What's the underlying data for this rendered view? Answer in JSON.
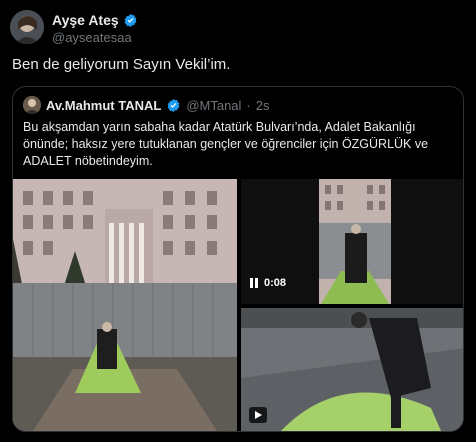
{
  "tweet": {
    "author": {
      "display_name": "Ayşe Ateş",
      "handle": "@ayseatesaa"
    },
    "text": "Ben de geliyorum Sayın Vekil’im."
  },
  "quoted": {
    "author": {
      "display_name": "Av.Mahmut TANAL",
      "handle": "@MTanal"
    },
    "separator": "·",
    "time": "2s",
    "text": "Bu akşamdan yarın sabaha kadar Atatürk Bulvarı’nda, Adalet Bakanlığı önünde; haksız yere tutuklanan gençler ve öğrenciler için ÖZGÜRLÜK ve ADALET nöbetindeyim.",
    "media": {
      "video_time": "0:08"
    }
  },
  "colors": {
    "verified": "#1d9bf0",
    "background": "#000000",
    "muted": "#71767b",
    "text": "#e7e9ea",
    "border": "#2f3336"
  },
  "icons": {
    "verified": "verified-badge-icon",
    "pause": "pause-icon",
    "play": "play-icon"
  }
}
